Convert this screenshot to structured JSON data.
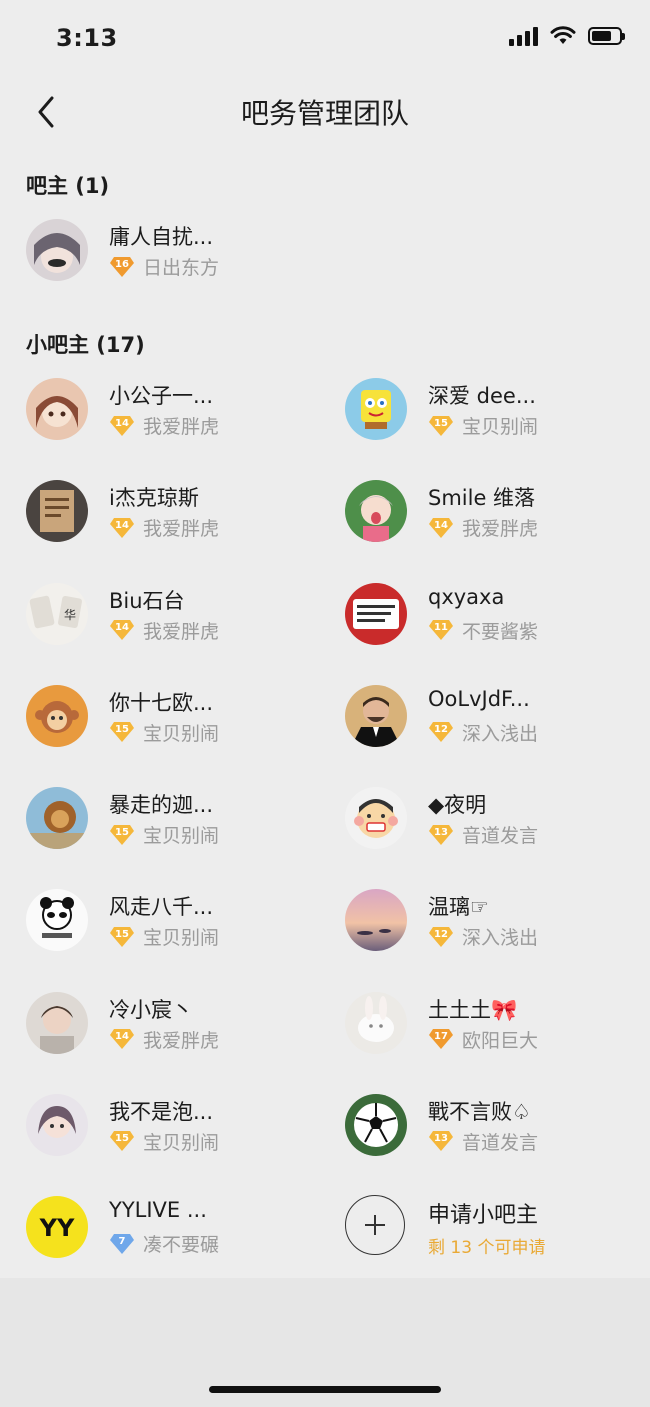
{
  "status_bar": {
    "time": "3:13",
    "battery_level": 0.72
  },
  "header": {
    "title": "吧务管理团队",
    "back_icon": "chevron-left-icon"
  },
  "owner_section": {
    "title": "吧主 (1)",
    "members": [
      {
        "name": "庸人自扰...",
        "level": "16",
        "forum": "日出东方"
      }
    ]
  },
  "moderator_section": {
    "title": "小吧主 (17)",
    "members": [
      {
        "name": "小公子一...",
        "level": "14",
        "forum": "我爱胖虎"
      },
      {
        "name": "深爱 dee...",
        "level": "15",
        "forum": "宝贝别闹"
      },
      {
        "name": "i杰克琼斯",
        "level": "14",
        "forum": "我爱胖虎"
      },
      {
        "name": "Smile 维落",
        "level": "14",
        "forum": "我爱胖虎"
      },
      {
        "name": "Biu石台",
        "level": "14",
        "forum": "我爱胖虎"
      },
      {
        "name": "qxyaxa",
        "level": "11",
        "forum": "不要酱紫"
      },
      {
        "name": "你十七欧...",
        "level": "15",
        "forum": "宝贝别闹"
      },
      {
        "name": "OoLvJdF...",
        "level": "12",
        "forum": "深入浅出"
      },
      {
        "name": "暴走的迦...",
        "level": "15",
        "forum": "宝贝别闹"
      },
      {
        "name": "◆夜明",
        "level": "13",
        "forum": "音道发言"
      },
      {
        "name": "风走八千...",
        "level": "15",
        "forum": "宝贝别闹"
      },
      {
        "name": "温璃☞",
        "level": "12",
        "forum": "深入浅出"
      },
      {
        "name": "冷小宸丶",
        "level": "14",
        "forum": "我爱胖虎"
      },
      {
        "name": "土土土🎀",
        "level": "17",
        "forum": "欧阳巨大"
      },
      {
        "name": "我不是泡...",
        "level": "15",
        "forum": "宝贝别闹"
      },
      {
        "name": "戰不言败♤",
        "level": "13",
        "forum": "音道发言"
      },
      {
        "name": "YYLIVE ...",
        "level": "7",
        "forum": "凑不要碾"
      }
    ]
  },
  "apply": {
    "label": "申请小吧主",
    "remaining": "剩 13 个可申请",
    "icon": "plus-icon"
  },
  "colors": {
    "badge_gold": "#f5b73a",
    "badge_orange": "#f09a2e",
    "badge_blue": "#6fa7ea",
    "apply_accent": "#e9a935",
    "forum_text": "#9b9b9b"
  },
  "avatar_icons": [
    "owner-avatar-icon",
    "anime-girl-avatar-icon",
    "sponge-cartoon-avatar-icon",
    "book-photo-avatar-icon",
    "cartoon-girl-avatar-icon",
    "cards-avatar-icon",
    "meme-text-avatar-icon",
    "monkey-avatar-icon",
    "man-in-suit-avatar-icon",
    "lion-avatar-icon",
    "cartoon-face-avatar-icon",
    "panda-meme-avatar-icon",
    "sunset-avatar-icon",
    "boy-portrait-avatar-icon",
    "rabbit-avatar-icon",
    "girl-portrait-avatar-icon",
    "soccer-ball-avatar-icon",
    "yy-logo-avatar-icon"
  ]
}
